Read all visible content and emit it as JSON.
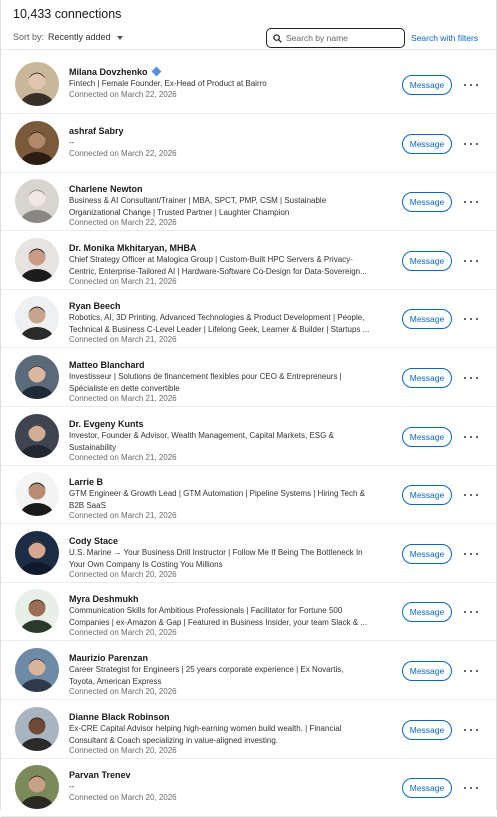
{
  "header": {
    "connections_count": "10,433 connections",
    "sort_label": "Sort by:",
    "sort_value": "Recently added",
    "search_placeholder": "Search by name",
    "advanced_search": "Search with filters"
  },
  "message_label": "Message",
  "colors": {
    "accent": "#0a66c2",
    "verified_badge": "#5b8fd9"
  },
  "connections": [
    {
      "name": "Milana Dovzhenko",
      "verified": true,
      "headline": [
        "Fintech | Female Founder, Ex-Head of Product at Bairro"
      ],
      "connected": "Connected on March 22, 2026"
    },
    {
      "name": "ashraf Sabry",
      "verified": false,
      "headline": [
        "--"
      ],
      "connected": "Connected on March 22, 2026"
    },
    {
      "name": "Charlene Newton",
      "verified": false,
      "headline": [
        "Business & AI Consultant/Trainer | MBA, SPCT, PMP, CSM | Sustainable",
        "Organizational Change | Trusted Partner | Laughter Champion"
      ],
      "connected": "Connected on March 22, 2026"
    },
    {
      "name": "Dr. Monika Mkhitaryan, MHBA",
      "verified": false,
      "headline": [
        "Chief Strategy Officer at Malogica Group | Custom-Built HPC Servers & Privacy-",
        "Centric, Enterprise-Tailored AI | Hardware-Software Co-Design for Data-Sovereign..."
      ],
      "connected": "Connected on March 21, 2026"
    },
    {
      "name": "Ryan Beech",
      "verified": false,
      "headline": [
        "Robotics, AI, 3D Printing, Advanced Technologies & Product Development | People,",
        "Technical & Business C-Level Leader | Lifelong Geek, Learner & Builder | Startups ..."
      ],
      "connected": "Connected on March 21, 2026"
    },
    {
      "name": "Matteo Blanchard",
      "verified": false,
      "headline": [
        "Investisseur | Solutions de financement flexibles pour CEO & Entrepreneurs |",
        "Spécialiste en dette convertible"
      ],
      "connected": "Connected on March 21, 2026"
    },
    {
      "name": "Dr. Evgeny Kunts",
      "verified": false,
      "headline": [
        "Investor, Founder & Advisor, Wealth Management, Capital Markets,  ESG &",
        "Sustainability"
      ],
      "connected": "Connected on March 21, 2026"
    },
    {
      "name": "Larrie B",
      "verified": false,
      "headline": [
        "GTM Engineer & Growth Lead | GTM Automation | Pipeline Systems | Hiring Tech &",
        "B2B SaaS"
      ],
      "connected": "Connected on March 21, 2026"
    },
    {
      "name": "Cody Stace",
      "verified": false,
      "headline": [
        "U.S. Marine → Your Business Drill Instructor | Follow Me If Being The Bottleneck In",
        "Your Own Company Is Costing You Millions"
      ],
      "connected": "Connected on March 20, 2026"
    },
    {
      "name": "Myra Deshmukh",
      "verified": false,
      "headline": [
        "Communication Skills for Ambitious Professionals | Facilitator for Fortune 500",
        "Companies | ex-Amazon & Gap | Featured in Business Insider, your team Slack & ..."
      ],
      "connected": "Connected on March 20, 2026"
    },
    {
      "name": "Maurizio Parenzan",
      "verified": false,
      "headline": [
        "Career Strategist for Engineers | 25 years corporate experience  |  Ex Novartis,",
        "Toyota, American Express"
      ],
      "connected": "Connected on March 20, 2026"
    },
    {
      "name": "Dianne Black Robinson",
      "verified": false,
      "headline": [
        "Ex-CRE Capital Advisor helping high-earning women build wealth. | Financial",
        "Consultant & Coach specializing in value-aligned investing."
      ],
      "connected": "Connected on March 20, 2026"
    },
    {
      "name": "Parvan Trenev",
      "verified": false,
      "headline": [
        "--"
      ],
      "connected": "Connected on March 20, 2026"
    }
  ]
}
